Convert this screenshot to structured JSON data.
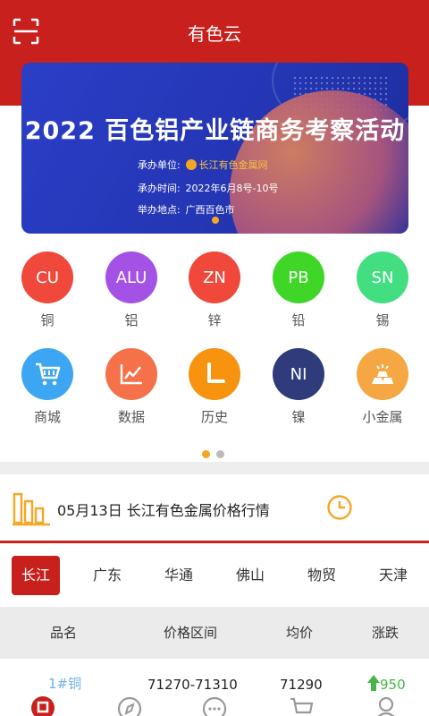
{
  "header": {
    "title": "有色云"
  },
  "banner": {
    "title": "2022 百色铝产业链商务考察活动",
    "rows": [
      {
        "label": "承办单位:",
        "value": "长江有色金属网"
      },
      {
        "label": "承办时间:",
        "value": "2022年6月8号-10号"
      },
      {
        "label": "举办地点:",
        "value": "广西百色市"
      }
    ]
  },
  "metals": [
    {
      "code": "CU",
      "label": "铜",
      "color": "#f0483a"
    },
    {
      "code": "ALU",
      "label": "铝",
      "color": "#a451e5"
    },
    {
      "code": "ZN",
      "label": "锌",
      "color": "#f0483a"
    },
    {
      "code": "PB",
      "label": "铅",
      "color": "#3fd627"
    },
    {
      "code": "SN",
      "label": "锡",
      "color": "#43dd82"
    }
  ],
  "shortcuts": [
    {
      "label": "商城",
      "icon": "cart-icon",
      "color": "#3ca6f2"
    },
    {
      "label": "数据",
      "icon": "chart-icon",
      "color": "#f4714a"
    },
    {
      "label": "历史",
      "icon": "clock-icon",
      "color": "#f7930e"
    },
    {
      "label": "镍",
      "code": "NI",
      "icon": "nickel-icon",
      "color": "#2f3b7a"
    },
    {
      "label": "小金属",
      "icon": "gold-bars-icon",
      "color": "#f4a742"
    }
  ],
  "news": {
    "text": "05月13日 长江有色金属价格行情"
  },
  "tabs": [
    "长江",
    "广东",
    "华通",
    "佛山",
    "物贸",
    "天津"
  ],
  "table": {
    "headers": [
      "品名",
      "价格区间",
      "均价",
      "涨跌"
    ],
    "rows": [
      {
        "name": "1#铜",
        "range": "71270-71310",
        "avg": "71290",
        "change": "950",
        "direction": "up"
      }
    ]
  },
  "colors": {
    "brand": "#c8201c",
    "up": "#45b649",
    "accent": "#f5a623"
  }
}
